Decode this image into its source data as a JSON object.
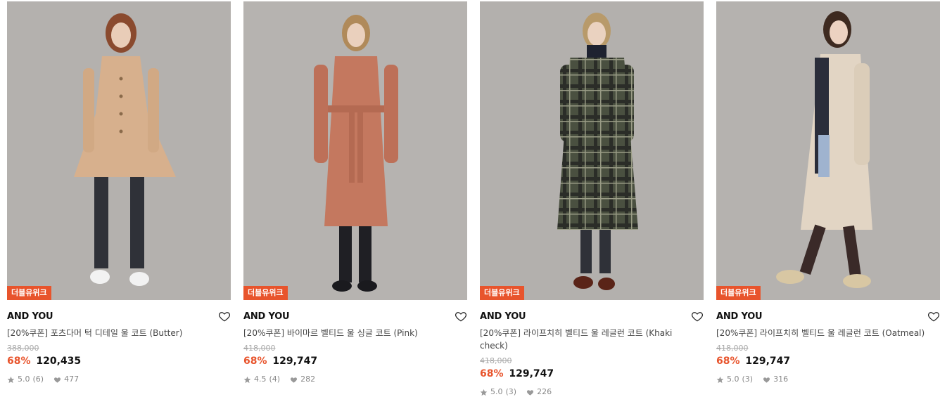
{
  "products": [
    {
      "badge": "더블유위크",
      "brand": "AND YOU",
      "name": "[20%쿠폰] 포츠다머 턱 디테일 울 코트 (Butter)",
      "original_price": "388,000",
      "discount": "68%",
      "price": "120,435",
      "rating": "5.0",
      "reviews": "(6)",
      "likes": "477",
      "coat_color": "#d7b08d",
      "bg_color": "#b4b1ae"
    },
    {
      "badge": "더블유위크",
      "brand": "AND YOU",
      "name": "[20%쿠폰] 바이마르 벨티드 울 싱글 코트 (Pink)",
      "original_price": "418,000",
      "discount": "68%",
      "price": "129,747",
      "rating": "4.5",
      "reviews": "(4)",
      "likes": "282",
      "coat_color": "#c4785f",
      "bg_color": "#b6b3b0"
    },
    {
      "badge": "더블유위크",
      "brand": "AND YOU",
      "name": "[20%쿠폰] 라이프치히 벨티드 울 레글런 코트 (Khaki check)",
      "original_price": "418,000",
      "discount": "68%",
      "price": "129,747",
      "rating": "5.0",
      "reviews": "(3)",
      "likes": "226",
      "coat_color": "#4a5040",
      "bg_color": "#b3b0ad"
    },
    {
      "badge": "더블유위크",
      "brand": "AND YOU",
      "name": "[20%쿠폰] 라이프치히 벨티드 울 레글런 코트 (Oatmeal)",
      "original_price": "418,000",
      "discount": "68%",
      "price": "129,747",
      "rating": "5.0",
      "reviews": "(3)",
      "likes": "316",
      "coat_color": "#e2d5c4",
      "bg_color": "#b5b2af"
    }
  ],
  "icons": {
    "wishlist": "heart-outline-icon",
    "rating": "star-icon",
    "likes": "heart-filled-icon"
  },
  "colors": {
    "accent": "#e8542c",
    "strike": "#aaaaaa",
    "meta": "#888888"
  }
}
